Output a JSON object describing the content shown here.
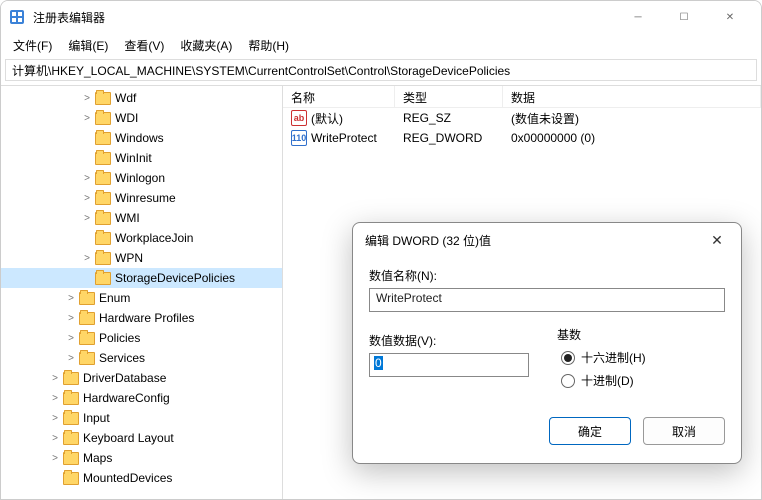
{
  "window": {
    "title": "注册表编辑器"
  },
  "menu": {
    "file": "文件(F)",
    "edit": "编辑(E)",
    "view": "查看(V)",
    "favorites": "收藏夹(A)",
    "help": "帮助(H)"
  },
  "address": "计算机\\HKEY_LOCAL_MACHINE\\SYSTEM\\CurrentControlSet\\Control\\StorageDevicePolicies",
  "tree": {
    "items": [
      {
        "label": "Wdf",
        "indent": 5,
        "twisty": ">"
      },
      {
        "label": "WDI",
        "indent": 5,
        "twisty": ">"
      },
      {
        "label": "Windows",
        "indent": 5,
        "twisty": ""
      },
      {
        "label": "WinInit",
        "indent": 5,
        "twisty": ""
      },
      {
        "label": "Winlogon",
        "indent": 5,
        "twisty": ">"
      },
      {
        "label": "Winresume",
        "indent": 5,
        "twisty": ">"
      },
      {
        "label": "WMI",
        "indent": 5,
        "twisty": ">"
      },
      {
        "label": "WorkplaceJoin",
        "indent": 5,
        "twisty": ""
      },
      {
        "label": "WPN",
        "indent": 5,
        "twisty": ">"
      },
      {
        "label": "StorageDevicePolicies",
        "indent": 5,
        "twisty": "",
        "selected": true
      },
      {
        "label": "Enum",
        "indent": 4,
        "twisty": ">"
      },
      {
        "label": "Hardware Profiles",
        "indent": 4,
        "twisty": ">"
      },
      {
        "label": "Policies",
        "indent": 4,
        "twisty": ">"
      },
      {
        "label": "Services",
        "indent": 4,
        "twisty": ">"
      },
      {
        "label": "DriverDatabase",
        "indent": 3,
        "twisty": ">"
      },
      {
        "label": "HardwareConfig",
        "indent": 3,
        "twisty": ">"
      },
      {
        "label": "Input",
        "indent": 3,
        "twisty": ">"
      },
      {
        "label": "Keyboard Layout",
        "indent": 3,
        "twisty": ">"
      },
      {
        "label": "Maps",
        "indent": 3,
        "twisty": ">"
      },
      {
        "label": "MountedDevices",
        "indent": 3,
        "twisty": ""
      }
    ]
  },
  "list": {
    "headers": {
      "name": "名称",
      "type": "类型",
      "data": "数据"
    },
    "rows": [
      {
        "icon": "sz",
        "iconText": "ab",
        "name": "(默认)",
        "type": "REG_SZ",
        "data": "(数值未设置)"
      },
      {
        "icon": "dw",
        "iconText": "110",
        "name": "WriteProtect",
        "type": "REG_DWORD",
        "data": "0x00000000 (0)"
      }
    ]
  },
  "dialog": {
    "title": "编辑 DWORD (32 位)值",
    "nameLabel": "数值名称(N):",
    "nameValue": "WriteProtect",
    "dataLabel": "数值数据(V):",
    "dataValue": "0",
    "radixLabel": "基数",
    "radioHex": "十六进制(H)",
    "radioDec": "十进制(D)",
    "ok": "确定",
    "cancel": "取消"
  }
}
